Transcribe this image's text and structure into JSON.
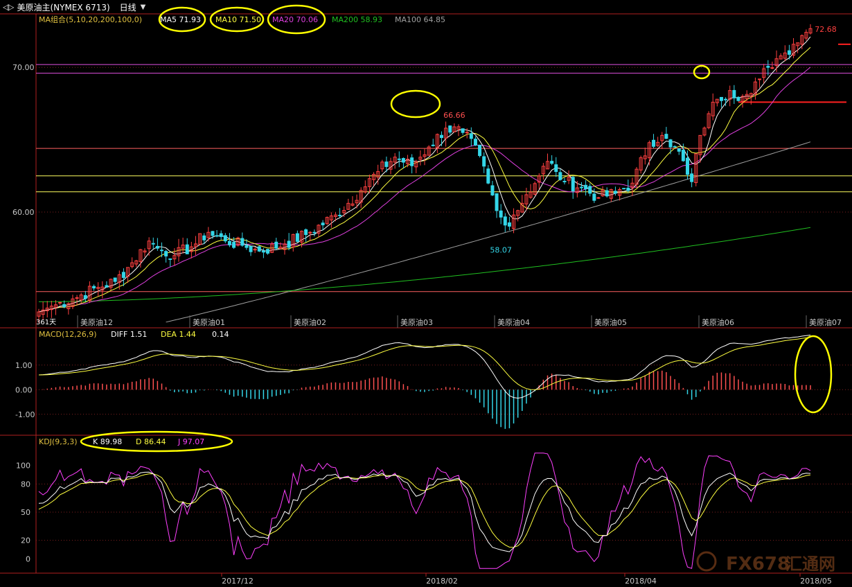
{
  "header": {
    "symbol": "美原油主(NYMEX 6713)",
    "period": "日线"
  },
  "colors": {
    "up": "#ff4040",
    "down": "#34d6e8",
    "ma5": "#ffffff",
    "ma10": "#ffff40",
    "ma20": "#e040e0",
    "ma200": "#20c020",
    "ma100": "#a0a0a0",
    "annot": "#ffff00"
  },
  "chart_data": [
    {
      "type": "candlestick",
      "title": "美原油主(NYMEX 6713) 日线",
      "ma_label": "MA组合(5,10,20,200,100,0)",
      "legend": [
        {
          "name": "MA5",
          "value": "71.93",
          "color": "#ffffff"
        },
        {
          "name": "MA10",
          "value": "71.50",
          "color": "#ffff40"
        },
        {
          "name": "MA20",
          "value": "70.06",
          "color": "#e040e0"
        },
        {
          "name": "MA200",
          "value": "58.93",
          "color": "#20c020"
        },
        {
          "name": "MA100",
          "value": "64.85",
          "color": "#a0a0a0"
        }
      ],
      "y_ticks": [
        "70.00",
        "60.00"
      ],
      "ylim": [
        52.0,
        73.7
      ],
      "annotations": {
        "high_mar": "66.66",
        "low_feb": "58.07",
        "latest": "72.68",
        "first_bar": "361天"
      },
      "contract_labels": [
        "美原油12",
        "美原油01",
        "美原油02",
        "美原油03",
        "美原油04",
        "美原油05",
        "美原油06",
        "美原油07"
      ],
      "horizontal_lines": [
        {
          "y": 70.2,
          "color": "#e050e0"
        },
        {
          "y": 69.6,
          "color": "#e050e0"
        },
        {
          "y": 64.4,
          "color": "#ff6060"
        },
        {
          "y": 62.5,
          "color": "#ffff60"
        },
        {
          "y": 61.4,
          "color": "#ffff60"
        },
        {
          "y": 54.5,
          "color": "#ff6060"
        }
      ],
      "support_segment": {
        "y": 67.6,
        "from_index": 165,
        "to_index": 180
      },
      "anchors": [
        [
          0,
          53.1
        ],
        [
          3,
          53.5
        ],
        [
          8,
          54.0
        ],
        [
          14,
          54.8
        ],
        [
          18,
          55.2
        ],
        [
          22,
          56.5
        ],
        [
          26,
          58.0
        ],
        [
          28,
          57.5
        ],
        [
          32,
          57.0
        ],
        [
          36,
          57.6
        ],
        [
          40,
          58.6
        ],
        [
          44,
          58.0
        ],
        [
          48,
          57.7
        ],
        [
          52,
          57.3
        ],
        [
          58,
          57.8
        ],
        [
          64,
          58.6
        ],
        [
          70,
          59.8
        ],
        [
          76,
          61.5
        ],
        [
          80,
          62.8
        ],
        [
          84,
          63.8
        ],
        [
          88,
          63.2
        ],
        [
          92,
          64.5
        ],
        [
          96,
          65.8
        ],
        [
          100,
          65.5
        ],
        [
          104,
          63.9
        ],
        [
          106,
          62.0
        ],
        [
          108,
          60.1
        ],
        [
          110,
          59.1
        ],
        [
          112,
          59.8
        ],
        [
          115,
          61.2
        ],
        [
          118,
          62.5
        ],
        [
          120,
          63.5
        ],
        [
          122,
          62.8
        ],
        [
          124,
          62.1
        ],
        [
          128,
          61.7
        ],
        [
          132,
          61.0
        ],
        [
          136,
          61.3
        ],
        [
          140,
          62.0
        ],
        [
          144,
          64.8
        ],
        [
          147,
          65.3
        ],
        [
          149,
          64.5
        ],
        [
          151,
          64.2
        ],
        [
          153,
          62.6
        ],
        [
          154,
          62.1
        ],
        [
          156,
          65.3
        ],
        [
          158,
          66.8
        ],
        [
          160,
          67.8
        ],
        [
          163,
          68.4
        ],
        [
          166,
          68.0
        ],
        [
          168,
          68.2
        ],
        [
          170,
          69.2
        ],
        [
          172,
          70.0
        ],
        [
          174,
          70.6
        ],
        [
          176,
          71.0
        ],
        [
          178,
          71.6
        ],
        [
          180,
          72.2
        ],
        [
          182,
          72.68
        ]
      ],
      "macd": {
        "label": "MACD(12,26,9)",
        "diff": "1.51",
        "dea": "1.44",
        "hist": "0.14",
        "y_ticks": [
          "1.00",
          "0.00",
          "-1.00"
        ],
        "ylim": [
          -1.85,
          1.95
        ]
      },
      "kdj": {
        "label": "KDJ(9,3,3)",
        "k": "89.98",
        "d": "86.44",
        "j": "97.07",
        "y_ticks": [
          "100",
          "80",
          "50",
          "20",
          "0"
        ],
        "ylim": [
          -15,
          118
        ]
      },
      "x_labels": [
        "2017/12",
        "2018/02",
        "2018/04",
        "2018/05"
      ]
    }
  ],
  "watermark": {
    "brand": "FX678",
    "suffix": "汇通网"
  }
}
